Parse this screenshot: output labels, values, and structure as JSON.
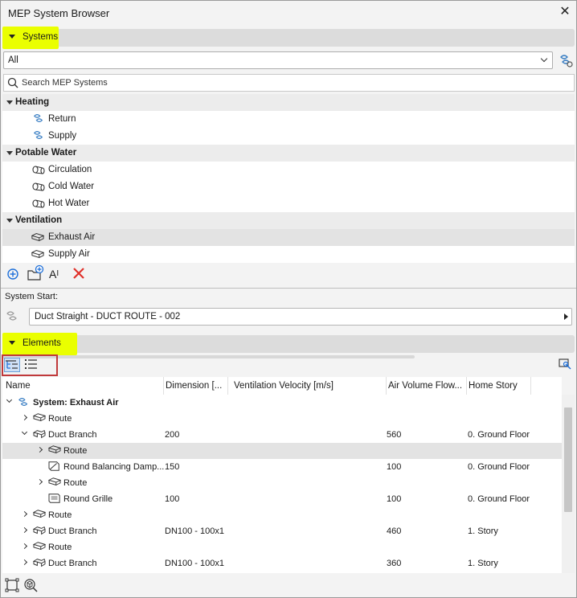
{
  "window": {
    "title": "MEP System Browser"
  },
  "systems_section": {
    "label": "Systems"
  },
  "filter": {
    "value": "All"
  },
  "search": {
    "placeholder": "Search MEP Systems"
  },
  "groups": [
    {
      "label": "Heating",
      "items": [
        {
          "label": "Return",
          "icon": "heating-system-icon"
        },
        {
          "label": "Supply",
          "icon": "heating-system-icon"
        }
      ]
    },
    {
      "label": "Potable Water",
      "items": [
        {
          "label": "Circulation",
          "icon": "pipe-icon"
        },
        {
          "label": "Cold Water",
          "icon": "pipe-icon"
        },
        {
          "label": "Hot Water",
          "icon": "pipe-icon"
        }
      ]
    },
    {
      "label": "Ventilation",
      "items": [
        {
          "label": "Exhaust Air",
          "icon": "duct-icon",
          "selected": true
        },
        {
          "label": "Supply Air",
          "icon": "duct-icon"
        }
      ]
    }
  ],
  "system_start": {
    "label": "System Start:",
    "value": "Duct Straight - DUCT ROUTE - 002"
  },
  "elements_section": {
    "label": "Elements"
  },
  "table": {
    "columns": [
      "Name",
      "Dimension [...",
      "Ventilation Velocity [m/s]",
      "Air Volume Flow...",
      "Home Story"
    ],
    "rows": [
      {
        "name": "System: Exhaust Air",
        "dim": "",
        "vel": "",
        "flow": "",
        "story": "",
        "level": 0,
        "expander": "open",
        "bold": true,
        "icon": "system"
      },
      {
        "name": "Route",
        "dim": "",
        "vel": "",
        "flow": "",
        "story": "",
        "level": 1,
        "expander": "closed",
        "icon": "duct"
      },
      {
        "name": "Duct Branch",
        "dim": "200",
        "vel": "",
        "flow": "560",
        "story": "0. Ground Floor",
        "level": 1,
        "expander": "open",
        "icon": "branch"
      },
      {
        "name": "Route",
        "dim": "",
        "vel": "",
        "flow": "",
        "story": "",
        "level": 2,
        "expander": "closed",
        "icon": "duct",
        "selected": true
      },
      {
        "name": "Round Balancing Damp...",
        "dim": "150",
        "vel": "",
        "flow": "100",
        "story": "0. Ground Floor",
        "level": 2,
        "expander": "none",
        "icon": "damper"
      },
      {
        "name": "Route",
        "dim": "",
        "vel": "",
        "flow": "",
        "story": "",
        "level": 2,
        "expander": "closed",
        "icon": "duct"
      },
      {
        "name": "Round Grille",
        "dim": "100",
        "vel": "",
        "flow": "100",
        "story": "0. Ground Floor",
        "level": 2,
        "expander": "none",
        "icon": "grille"
      },
      {
        "name": "Route",
        "dim": "",
        "vel": "",
        "flow": "",
        "story": "",
        "level": 1,
        "expander": "closed",
        "icon": "duct"
      },
      {
        "name": "Duct Branch",
        "dim": "DN100 - 100x1",
        "vel": "",
        "flow": "460",
        "story": "1. Story",
        "level": 1,
        "expander": "closed",
        "icon": "branch"
      },
      {
        "name": "Route",
        "dim": "",
        "vel": "",
        "flow": "",
        "story": "",
        "level": 1,
        "expander": "closed",
        "icon": "duct"
      },
      {
        "name": "Duct Branch",
        "dim": "DN100 - 100x1",
        "vel": "",
        "flow": "360",
        "story": "1. Story",
        "level": 1,
        "expander": "closed",
        "icon": "branch"
      }
    ]
  },
  "colors": {
    "highlight": "#eaff00",
    "annotation_box": "#c0393b",
    "add_blue": "#1e6fd9",
    "delete_red": "#e0302a"
  }
}
